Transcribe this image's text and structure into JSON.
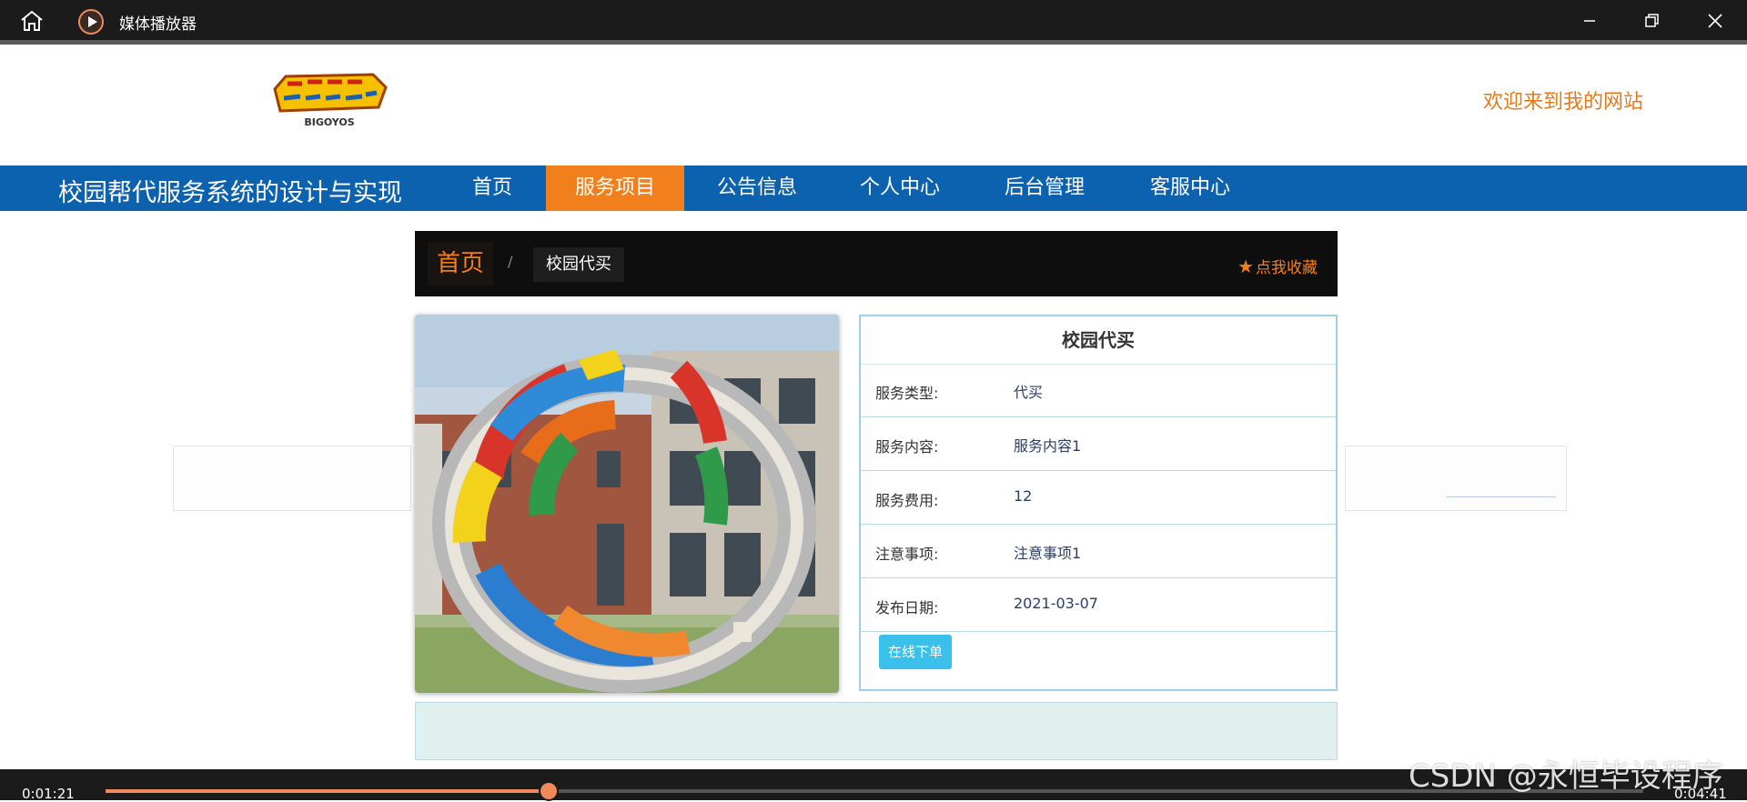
{
  "player": {
    "title": "媒体播放器",
    "current_time": "0:01:21",
    "total_time": "0:04:41",
    "progress": 0.2883,
    "accent_color": "#f08a5d"
  },
  "header": {
    "logo_text": "BIGOYOS",
    "welcome": "欢迎来到我的网站"
  },
  "nav": {
    "site_title": "校园帮代服务系统的设计与实现",
    "items": [
      {
        "label": "首页"
      },
      {
        "label": "服务项目",
        "active": true
      },
      {
        "label": "公告信息"
      },
      {
        "label": "个人中心"
      },
      {
        "label": "后台管理"
      },
      {
        "label": "客服中心"
      }
    ],
    "bar_color": "#0d62b0",
    "active_color": "#f17f1c"
  },
  "breadcrumb": {
    "home": "首页",
    "separator": "/",
    "current": "校园代买",
    "favorite": "点我收藏"
  },
  "detail": {
    "title": "校园代买",
    "rows": [
      {
        "label": "服务类型:",
        "value": "代买"
      },
      {
        "label": "服务内容:",
        "value": "服务内容1"
      },
      {
        "label": "服务费用:",
        "value": "12"
      },
      {
        "label": "注意事项:",
        "value": "注意事项1"
      },
      {
        "label": "发布日期:",
        "value": "2021-03-07"
      }
    ],
    "order_button": "在线下单"
  },
  "watermark": "CSDN @永恒毕设程序",
  "icons": {
    "home": "home-icon",
    "app": "play-circle-icon",
    "minimize": "minimize-icon",
    "maximize": "restore-icon",
    "close": "close-icon",
    "favorite": "star-icon"
  }
}
